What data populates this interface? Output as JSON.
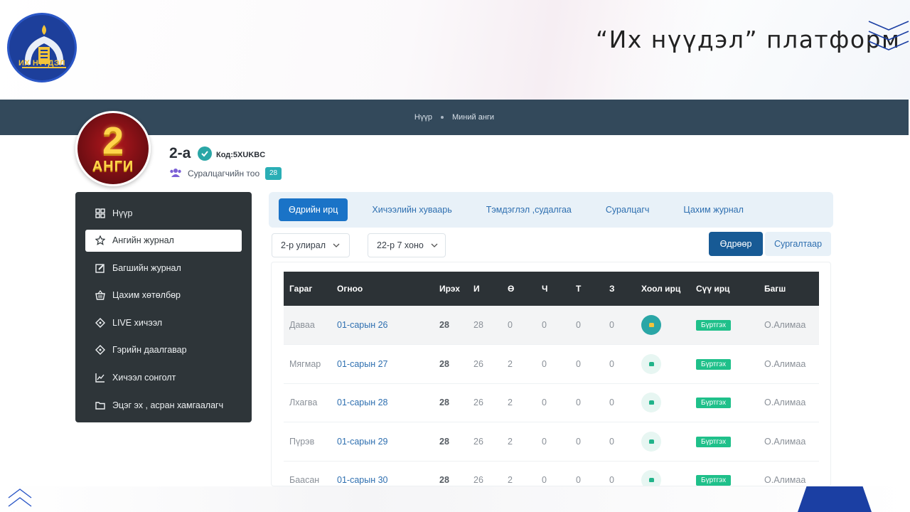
{
  "slide": {
    "logo_text": "ИХ НҮҮДЭЛ",
    "title": "“Их нүүдэл” платформ"
  },
  "header": {
    "breadcrumb": [
      "Нүүр",
      "Миний анги"
    ]
  },
  "class_info": {
    "badge_number": "2",
    "badge_word": "АНГИ",
    "name": "2-а",
    "code": "Код:5XUKBC",
    "students_label": "Суралцагчийн тоо",
    "students_count": "28"
  },
  "sidebar": {
    "items": [
      {
        "label": "Нүүр",
        "icon": "dashboard-icon"
      },
      {
        "label": "Ангийн журнал",
        "icon": "star-icon",
        "active": true
      },
      {
        "label": "Багшийн журнал",
        "icon": "edit-icon"
      },
      {
        "label": "Цахим хөтөлбөр",
        "icon": "basket-icon"
      },
      {
        "label": "LIVE хичээл",
        "icon": "diamond-icon"
      },
      {
        "label": "Гэрийн даалгавар",
        "icon": "diamond-icon"
      },
      {
        "label": "Хичээл сонголт",
        "icon": "chart-icon"
      },
      {
        "label": "Эцэг эх , асран хамгаалагч",
        "icon": "folder-icon"
      }
    ]
  },
  "tabs": [
    "Өдрийн ирц",
    "Хичээлийн хуваарь",
    "Тэмдэглэл ,судалгаа",
    "Суралцагч",
    "Цахим журнал"
  ],
  "filters": {
    "semester": "2-р улирал",
    "week": "22-р 7 хоно",
    "by_day": "Өдрөөр",
    "by_lesson": "Сургалтаар"
  },
  "table": {
    "headers": [
      "Гараг",
      "Огноо",
      "Ирэх",
      "И",
      "Ө",
      "Ч",
      "Т",
      "З",
      "Хоол ирц",
      "Сүү ирц",
      "Багш"
    ],
    "rows": [
      [
        "Даваа",
        "01-сарын 26",
        "28",
        "28",
        "0",
        "0",
        "0",
        "0",
        "",
        "Бүртгэх",
        "О.Алимаа"
      ],
      [
        "Мягмар",
        "01-сарын 27",
        "28",
        "26",
        "2",
        "0",
        "0",
        "0",
        "",
        "Бүртгэх",
        "О.Алимаа"
      ],
      [
        "Лхагва",
        "01-сарын 28",
        "28",
        "26",
        "2",
        "0",
        "0",
        "0",
        "",
        "Бүртгэх",
        "О.Алимаа"
      ],
      [
        "Пүрэв",
        "01-сарын 29",
        "28",
        "26",
        "2",
        "0",
        "0",
        "0",
        "",
        "Бүртгэх",
        "О.Алимаа"
      ],
      [
        "Баасан",
        "01-сарын 30",
        "28",
        "26",
        "2",
        "0",
        "0",
        "0",
        "",
        "Бүртгэх",
        "О.Алимаа"
      ]
    ]
  },
  "colors": {
    "header_bar": "#33495b",
    "primary": "#1a73c7",
    "accent_teal": "#2aa6a6",
    "register_badge": "#1fc08a"
  }
}
